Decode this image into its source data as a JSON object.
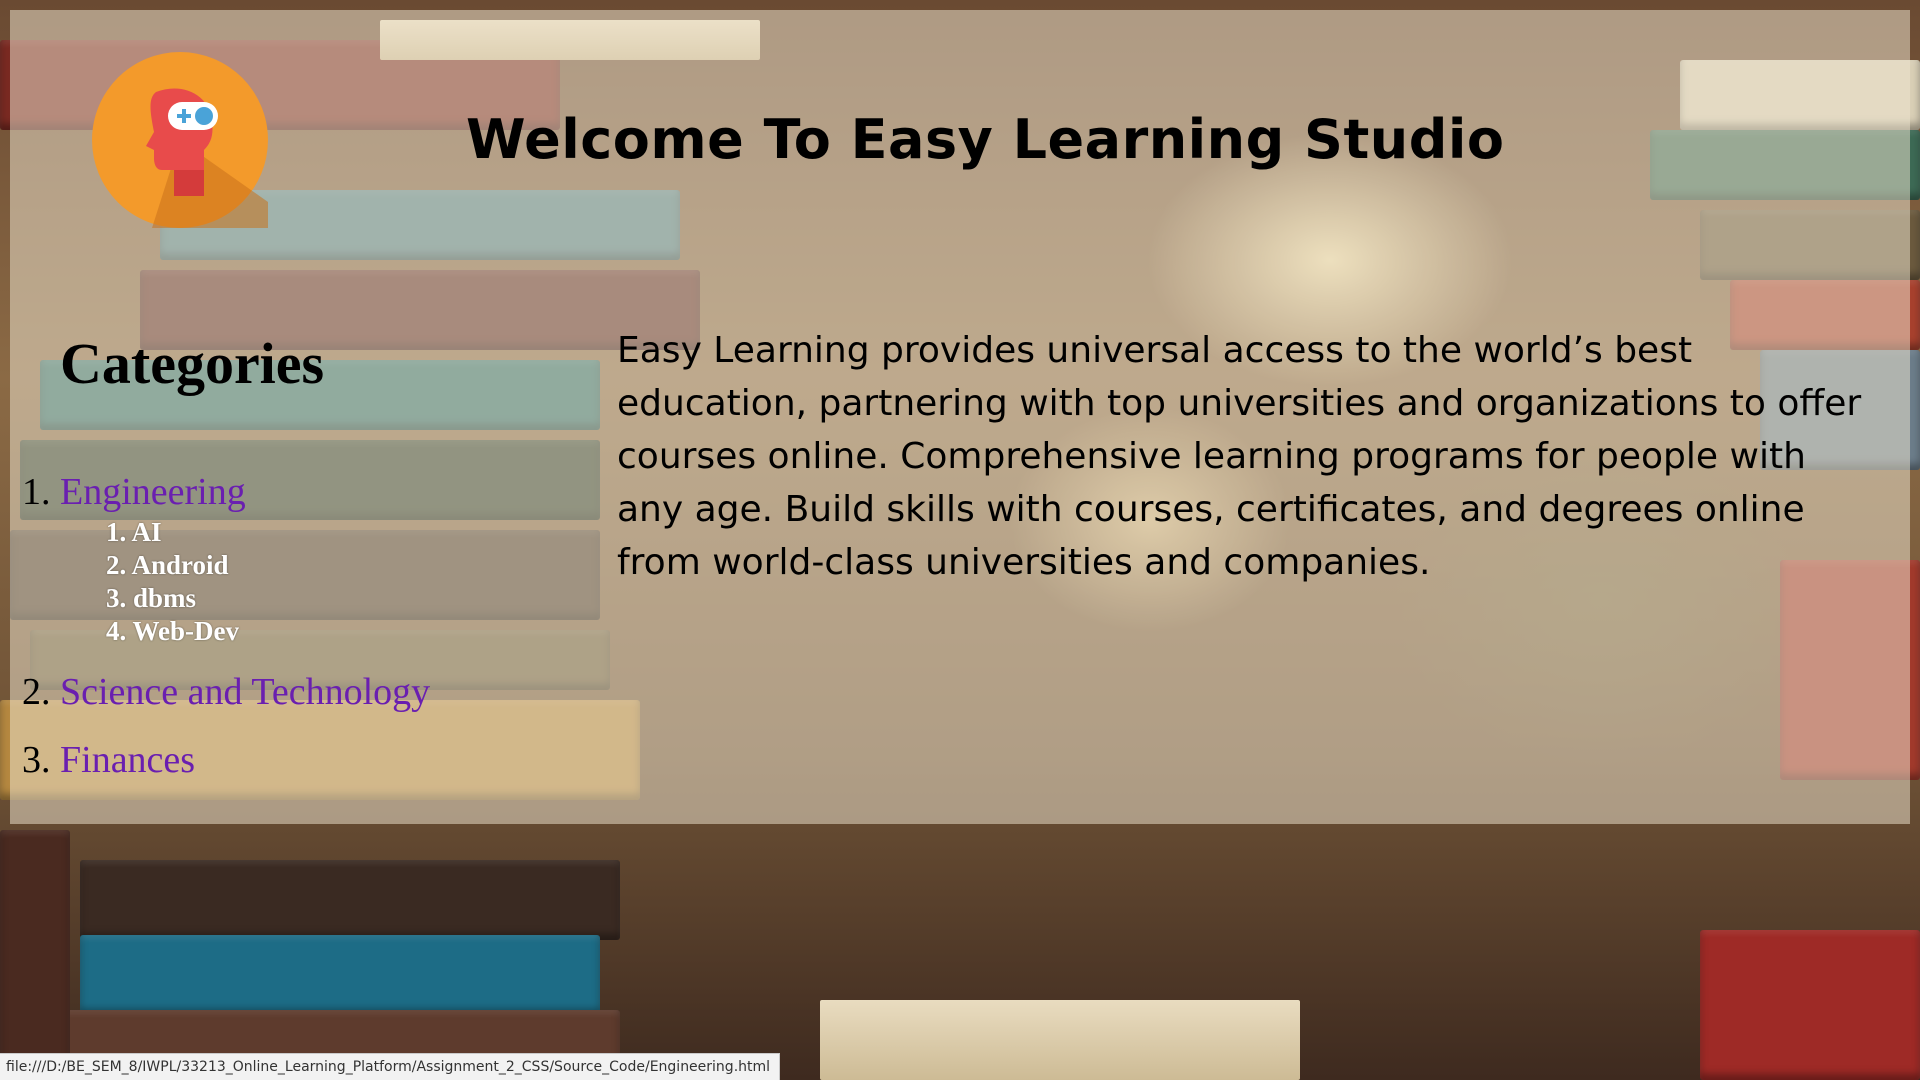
{
  "header": {
    "title": "Welcome To Easy Learning Studio",
    "logo_icon": "brain-gamepad-head-icon"
  },
  "categories": {
    "heading": "Categories",
    "items": [
      {
        "number": "1.",
        "label": "Engineering",
        "subitems": [
          {
            "number": "1.",
            "label": "AI"
          },
          {
            "number": "2.",
            "label": "Android"
          },
          {
            "number": "3.",
            "label": "dbms"
          },
          {
            "number": "4.",
            "label": "Web-Dev"
          }
        ]
      },
      {
        "number": "2.",
        "label": "Science and Technology"
      },
      {
        "number": "3.",
        "label": "Finances"
      }
    ]
  },
  "main": {
    "description": "Easy Learning provides universal access to the world’s best education, partnering with top universities and organizations to offer courses online. Comprehensive learning programs for people with any age. Build skills with courses, certificates, and degrees online from world-class universities and companies."
  },
  "status_bar": {
    "url": "file:///D:/BE_SEM_8/IWPL/33213_Online_Learning_Platform/Assignment_2_CSS/Source_Code/Engineering.html"
  },
  "colors": {
    "link": "#6a1fb0",
    "logo_circle": "#f39a2b",
    "logo_head": "#e84b4b",
    "logo_controller": "#4aa3d8",
    "panel_overlay": "rgba(238,228,208,0.52)"
  }
}
